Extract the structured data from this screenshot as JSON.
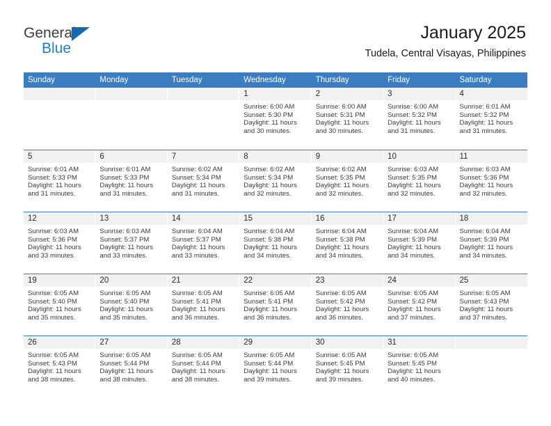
{
  "brand": {
    "name_part1": "General",
    "name_part2": "Blue",
    "accent_color": "#1f7fc4",
    "triangle_color": "#1668b3"
  },
  "header": {
    "title": "January 2025",
    "subtitle": "Tudela, Central Visayas, Philippines"
  },
  "theme": {
    "header_row_bg": "#3b7dc0",
    "day_band_bg": "#f1f1f1",
    "row_divider": "#3b7dc0"
  },
  "calendar": {
    "weekday_headers": [
      "Sunday",
      "Monday",
      "Tuesday",
      "Wednesday",
      "Thursday",
      "Friday",
      "Saturday"
    ],
    "weeks": [
      [
        {
          "day": "",
          "sunrise": "",
          "sunset": "",
          "daylight_line1": "",
          "daylight_line2": ""
        },
        {
          "day": "",
          "sunrise": "",
          "sunset": "",
          "daylight_line1": "",
          "daylight_line2": ""
        },
        {
          "day": "",
          "sunrise": "",
          "sunset": "",
          "daylight_line1": "",
          "daylight_line2": ""
        },
        {
          "day": "1",
          "sunrise": "Sunrise: 6:00 AM",
          "sunset": "Sunset: 5:30 PM",
          "daylight_line1": "Daylight: 11 hours",
          "daylight_line2": "and 30 minutes."
        },
        {
          "day": "2",
          "sunrise": "Sunrise: 6:00 AM",
          "sunset": "Sunset: 5:31 PM",
          "daylight_line1": "Daylight: 11 hours",
          "daylight_line2": "and 30 minutes."
        },
        {
          "day": "3",
          "sunrise": "Sunrise: 6:00 AM",
          "sunset": "Sunset: 5:32 PM",
          "daylight_line1": "Daylight: 11 hours",
          "daylight_line2": "and 31 minutes."
        },
        {
          "day": "4",
          "sunrise": "Sunrise: 6:01 AM",
          "sunset": "Sunset: 5:32 PM",
          "daylight_line1": "Daylight: 11 hours",
          "daylight_line2": "and 31 minutes."
        }
      ],
      [
        {
          "day": "5",
          "sunrise": "Sunrise: 6:01 AM",
          "sunset": "Sunset: 5:33 PM",
          "daylight_line1": "Daylight: 11 hours",
          "daylight_line2": "and 31 minutes."
        },
        {
          "day": "6",
          "sunrise": "Sunrise: 6:01 AM",
          "sunset": "Sunset: 5:33 PM",
          "daylight_line1": "Daylight: 11 hours",
          "daylight_line2": "and 31 minutes."
        },
        {
          "day": "7",
          "sunrise": "Sunrise: 6:02 AM",
          "sunset": "Sunset: 5:34 PM",
          "daylight_line1": "Daylight: 11 hours",
          "daylight_line2": "and 31 minutes."
        },
        {
          "day": "8",
          "sunrise": "Sunrise: 6:02 AM",
          "sunset": "Sunset: 5:34 PM",
          "daylight_line1": "Daylight: 11 hours",
          "daylight_line2": "and 32 minutes."
        },
        {
          "day": "9",
          "sunrise": "Sunrise: 6:02 AM",
          "sunset": "Sunset: 5:35 PM",
          "daylight_line1": "Daylight: 11 hours",
          "daylight_line2": "and 32 minutes."
        },
        {
          "day": "10",
          "sunrise": "Sunrise: 6:03 AM",
          "sunset": "Sunset: 5:35 PM",
          "daylight_line1": "Daylight: 11 hours",
          "daylight_line2": "and 32 minutes."
        },
        {
          "day": "11",
          "sunrise": "Sunrise: 6:03 AM",
          "sunset": "Sunset: 5:36 PM",
          "daylight_line1": "Daylight: 11 hours",
          "daylight_line2": "and 32 minutes."
        }
      ],
      [
        {
          "day": "12",
          "sunrise": "Sunrise: 6:03 AM",
          "sunset": "Sunset: 5:36 PM",
          "daylight_line1": "Daylight: 11 hours",
          "daylight_line2": "and 33 minutes."
        },
        {
          "day": "13",
          "sunrise": "Sunrise: 6:03 AM",
          "sunset": "Sunset: 5:37 PM",
          "daylight_line1": "Daylight: 11 hours",
          "daylight_line2": "and 33 minutes."
        },
        {
          "day": "14",
          "sunrise": "Sunrise: 6:04 AM",
          "sunset": "Sunset: 5:37 PM",
          "daylight_line1": "Daylight: 11 hours",
          "daylight_line2": "and 33 minutes."
        },
        {
          "day": "15",
          "sunrise": "Sunrise: 6:04 AM",
          "sunset": "Sunset: 5:38 PM",
          "daylight_line1": "Daylight: 11 hours",
          "daylight_line2": "and 34 minutes."
        },
        {
          "day": "16",
          "sunrise": "Sunrise: 6:04 AM",
          "sunset": "Sunset: 5:38 PM",
          "daylight_line1": "Daylight: 11 hours",
          "daylight_line2": "and 34 minutes."
        },
        {
          "day": "17",
          "sunrise": "Sunrise: 6:04 AM",
          "sunset": "Sunset: 5:39 PM",
          "daylight_line1": "Daylight: 11 hours",
          "daylight_line2": "and 34 minutes."
        },
        {
          "day": "18",
          "sunrise": "Sunrise: 6:04 AM",
          "sunset": "Sunset: 5:39 PM",
          "daylight_line1": "Daylight: 11 hours",
          "daylight_line2": "and 34 minutes."
        }
      ],
      [
        {
          "day": "19",
          "sunrise": "Sunrise: 6:05 AM",
          "sunset": "Sunset: 5:40 PM",
          "daylight_line1": "Daylight: 11 hours",
          "daylight_line2": "and 35 minutes."
        },
        {
          "day": "20",
          "sunrise": "Sunrise: 6:05 AM",
          "sunset": "Sunset: 5:40 PM",
          "daylight_line1": "Daylight: 11 hours",
          "daylight_line2": "and 35 minutes."
        },
        {
          "day": "21",
          "sunrise": "Sunrise: 6:05 AM",
          "sunset": "Sunset: 5:41 PM",
          "daylight_line1": "Daylight: 11 hours",
          "daylight_line2": "and 36 minutes."
        },
        {
          "day": "22",
          "sunrise": "Sunrise: 6:05 AM",
          "sunset": "Sunset: 5:41 PM",
          "daylight_line1": "Daylight: 11 hours",
          "daylight_line2": "and 36 minutes."
        },
        {
          "day": "23",
          "sunrise": "Sunrise: 6:05 AM",
          "sunset": "Sunset: 5:42 PM",
          "daylight_line1": "Daylight: 11 hours",
          "daylight_line2": "and 36 minutes."
        },
        {
          "day": "24",
          "sunrise": "Sunrise: 6:05 AM",
          "sunset": "Sunset: 5:42 PM",
          "daylight_line1": "Daylight: 11 hours",
          "daylight_line2": "and 37 minutes."
        },
        {
          "day": "25",
          "sunrise": "Sunrise: 6:05 AM",
          "sunset": "Sunset: 5:43 PM",
          "daylight_line1": "Daylight: 11 hours",
          "daylight_line2": "and 37 minutes."
        }
      ],
      [
        {
          "day": "26",
          "sunrise": "Sunrise: 6:05 AM",
          "sunset": "Sunset: 5:43 PM",
          "daylight_line1": "Daylight: 11 hours",
          "daylight_line2": "and 38 minutes."
        },
        {
          "day": "27",
          "sunrise": "Sunrise: 6:05 AM",
          "sunset": "Sunset: 5:44 PM",
          "daylight_line1": "Daylight: 11 hours",
          "daylight_line2": "and 38 minutes."
        },
        {
          "day": "28",
          "sunrise": "Sunrise: 6:05 AM",
          "sunset": "Sunset: 5:44 PM",
          "daylight_line1": "Daylight: 11 hours",
          "daylight_line2": "and 38 minutes."
        },
        {
          "day": "29",
          "sunrise": "Sunrise: 6:05 AM",
          "sunset": "Sunset: 5:44 PM",
          "daylight_line1": "Daylight: 11 hours",
          "daylight_line2": "and 39 minutes."
        },
        {
          "day": "30",
          "sunrise": "Sunrise: 6:05 AM",
          "sunset": "Sunset: 5:45 PM",
          "daylight_line1": "Daylight: 11 hours",
          "daylight_line2": "and 39 minutes."
        },
        {
          "day": "31",
          "sunrise": "Sunrise: 6:05 AM",
          "sunset": "Sunset: 5:45 PM",
          "daylight_line1": "Daylight: 11 hours",
          "daylight_line2": "and 40 minutes."
        },
        {
          "day": "",
          "sunrise": "",
          "sunset": "",
          "daylight_line1": "",
          "daylight_line2": ""
        }
      ]
    ]
  }
}
